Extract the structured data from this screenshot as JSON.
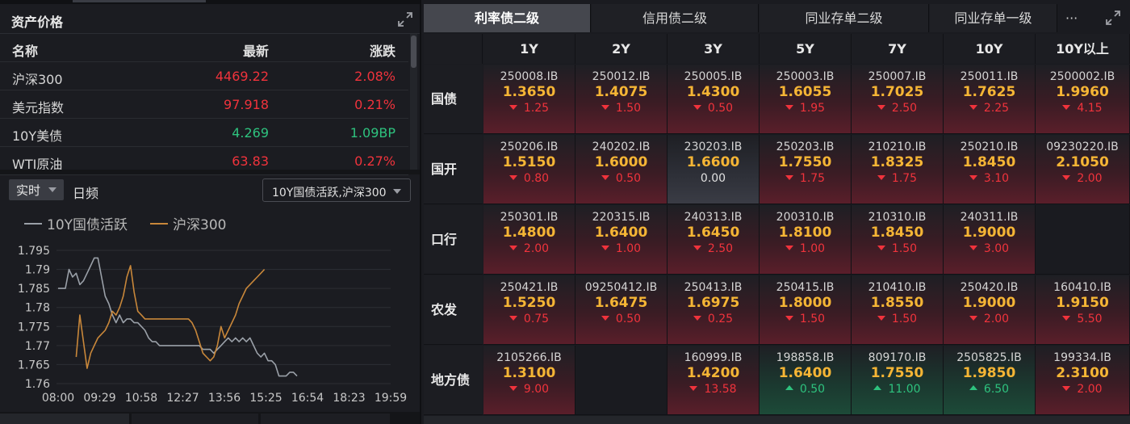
{
  "asset_panel": {
    "title": "资产价格",
    "headers": [
      "名称",
      "最新",
      "涨跌"
    ],
    "rows": [
      {
        "name": "沪深300",
        "last": "4469.22",
        "change": "2.08%",
        "dir": "up"
      },
      {
        "name": "美元指数",
        "last": "97.918",
        "change": "0.21%",
        "dir": "up"
      },
      {
        "name": "10Y美债",
        "last": "4.269",
        "change": "1.09BP",
        "dir": "down"
      },
      {
        "name": "WTI原油",
        "last": "63.83",
        "change": "0.27%",
        "dir": "up"
      }
    ]
  },
  "chart_controls": {
    "realtime_label": "实时",
    "daily_label": "日频",
    "series_select": "10Y国债活跃,沪深300"
  },
  "chart_data": {
    "type": "line",
    "series": [
      {
        "name": "10Y国债活跃",
        "color": "#9aa0a8",
        "values": [
          1.785,
          1.785,
          1.785,
          1.79,
          1.788,
          1.789,
          1.786,
          1.787,
          1.789,
          1.791,
          1.793,
          1.793,
          1.788,
          1.783,
          1.781,
          1.778,
          1.776,
          1.778,
          1.776,
          1.777,
          1.777,
          1.776,
          1.776,
          1.775,
          1.774,
          1.772,
          1.771,
          1.771,
          1.77,
          1.77,
          1.77,
          1.77,
          1.77,
          1.77,
          1.77,
          1.77,
          1.77,
          1.77,
          1.77,
          1.77,
          1.769,
          1.769,
          1.769,
          1.768,
          1.769,
          1.77,
          1.771,
          1.772,
          1.771,
          1.772,
          1.771,
          1.772,
          1.771,
          1.772,
          1.77,
          1.768,
          1.767,
          1.768,
          1.766,
          1.766,
          1.765,
          1.762,
          1.762,
          1.762,
          1.763,
          1.763,
          1.762
        ]
      },
      {
        "name": "沪深300",
        "color": "#c8873a",
        "values": [
          null,
          null,
          null,
          null,
          null,
          1.767,
          1.778,
          1.771,
          1.764,
          1.768,
          1.77,
          1.772,
          1.773,
          1.774,
          1.776,
          1.779,
          1.778,
          1.78,
          1.783,
          1.788,
          1.791,
          1.784,
          1.779,
          1.778,
          1.777,
          1.777,
          1.777,
          1.777,
          1.777,
          1.777,
          1.777,
          1.777,
          1.777,
          1.777,
          1.777,
          1.777,
          1.777,
          1.776,
          1.774,
          1.771,
          1.768,
          1.767,
          1.766,
          1.767,
          1.77,
          1.775,
          1.772,
          1.774,
          1.776,
          1.778,
          1.781,
          1.783,
          1.785,
          1.786,
          1.787,
          1.788,
          1.789,
          1.79,
          null,
          null,
          null,
          null,
          null,
          null,
          null,
          null,
          null
        ]
      }
    ],
    "x_ticks": [
      "08:00",
      "09:29",
      "10:58",
      "12:27",
      "13:56",
      "15:25",
      "16:54",
      "18:23",
      "19:59"
    ],
    "y_ticks": [
      "1.795",
      "1.79",
      "1.785",
      "1.78",
      "1.775",
      "1.77",
      "1.765",
      "1.76"
    ],
    "ylim": [
      1.76,
      1.795
    ],
    "grid": true,
    "legend_position": "top-left"
  },
  "bond_panel": {
    "tabs": [
      "利率债二级",
      "信用债二级",
      "同业存单二级",
      "同业存单一级"
    ],
    "active_tab": 0,
    "more_label": "···",
    "columns": [
      "1Y",
      "2Y",
      "3Y",
      "5Y",
      "7Y",
      "10Y",
      "10Y以上"
    ],
    "rows": [
      {
        "name": "国债",
        "cells": [
          {
            "code": "250008.IB",
            "yield": "1.3650",
            "change": "1.25",
            "dir": "down"
          },
          {
            "code": "250012.IB",
            "yield": "1.4075",
            "change": "1.50",
            "dir": "down"
          },
          {
            "code": "250005.IB",
            "yield": "1.4300",
            "change": "0.50",
            "dir": "down"
          },
          {
            "code": "250003.IB",
            "yield": "1.6055",
            "change": "1.95",
            "dir": "down"
          },
          {
            "code": "250007.IB",
            "yield": "1.7025",
            "change": "2.50",
            "dir": "down"
          },
          {
            "code": "250011.IB",
            "yield": "1.7625",
            "change": "2.25",
            "dir": "down"
          },
          {
            "code": "2500002.IB",
            "yield": "1.9960",
            "change": "4.15",
            "dir": "down"
          }
        ]
      },
      {
        "name": "国开",
        "cells": [
          {
            "code": "250206.IB",
            "yield": "1.5150",
            "change": "0.80",
            "dir": "down"
          },
          {
            "code": "240202.IB",
            "yield": "1.6000",
            "change": "0.50",
            "dir": "down"
          },
          {
            "code": "230203.IB",
            "yield": "1.6600",
            "change": "0.00",
            "dir": "flat"
          },
          {
            "code": "250203.IB",
            "yield": "1.7550",
            "change": "1.75",
            "dir": "down"
          },
          {
            "code": "210210.IB",
            "yield": "1.8325",
            "change": "1.75",
            "dir": "down"
          },
          {
            "code": "250210.IB",
            "yield": "1.8450",
            "change": "3.10",
            "dir": "down"
          },
          {
            "code": "09230220.IB",
            "yield": "2.1050",
            "change": "2.00",
            "dir": "down"
          }
        ]
      },
      {
        "name": "口行",
        "cells": [
          {
            "code": "250301.IB",
            "yield": "1.4800",
            "change": "2.00",
            "dir": "down"
          },
          {
            "code": "220315.IB",
            "yield": "1.6400",
            "change": "1.00",
            "dir": "down"
          },
          {
            "code": "240313.IB",
            "yield": "1.6450",
            "change": "2.50",
            "dir": "down"
          },
          {
            "code": "200310.IB",
            "yield": "1.8100",
            "change": "1.00",
            "dir": "down"
          },
          {
            "code": "210310.IB",
            "yield": "1.8450",
            "change": "1.50",
            "dir": "down"
          },
          {
            "code": "240311.IB",
            "yield": "1.9000",
            "change": "3.00",
            "dir": "down"
          },
          null
        ]
      },
      {
        "name": "农发",
        "cells": [
          {
            "code": "250421.IB",
            "yield": "1.5250",
            "change": "0.75",
            "dir": "down"
          },
          {
            "code": "09250412.IB",
            "yield": "1.6475",
            "change": "0.50",
            "dir": "down"
          },
          {
            "code": "250413.IB",
            "yield": "1.6975",
            "change": "0.25",
            "dir": "down"
          },
          {
            "code": "250415.IB",
            "yield": "1.8000",
            "change": "1.50",
            "dir": "down"
          },
          {
            "code": "210410.IB",
            "yield": "1.8550",
            "change": "1.50",
            "dir": "down"
          },
          {
            "code": "250420.IB",
            "yield": "1.9000",
            "change": "2.00",
            "dir": "down"
          },
          {
            "code": "160410.IB",
            "yield": "1.9150",
            "change": "5.50",
            "dir": "down"
          }
        ]
      },
      {
        "name": "地方债",
        "cells": [
          {
            "code": "2105266.IB",
            "yield": "1.3100",
            "change": "9.00",
            "dir": "down"
          },
          null,
          {
            "code": "160999.IB",
            "yield": "1.4200",
            "change": "13.58",
            "dir": "down"
          },
          {
            "code": "198858.IB",
            "yield": "1.6400",
            "change": "0.50",
            "dir": "up"
          },
          {
            "code": "809170.IB",
            "yield": "1.7550",
            "change": "11.00",
            "dir": "up"
          },
          {
            "code": "2505825.IB",
            "yield": "1.9850",
            "change": "6.50",
            "dir": "up"
          },
          {
            "code": "199334.IB",
            "yield": "2.3100",
            "change": "2.00",
            "dir": "down"
          }
        ]
      }
    ]
  },
  "colors": {
    "up": "#f0333c",
    "down": "#2ec27e",
    "yield": "#f5b535",
    "bond_line": "#9aa0a8",
    "index_line": "#c8873a"
  }
}
